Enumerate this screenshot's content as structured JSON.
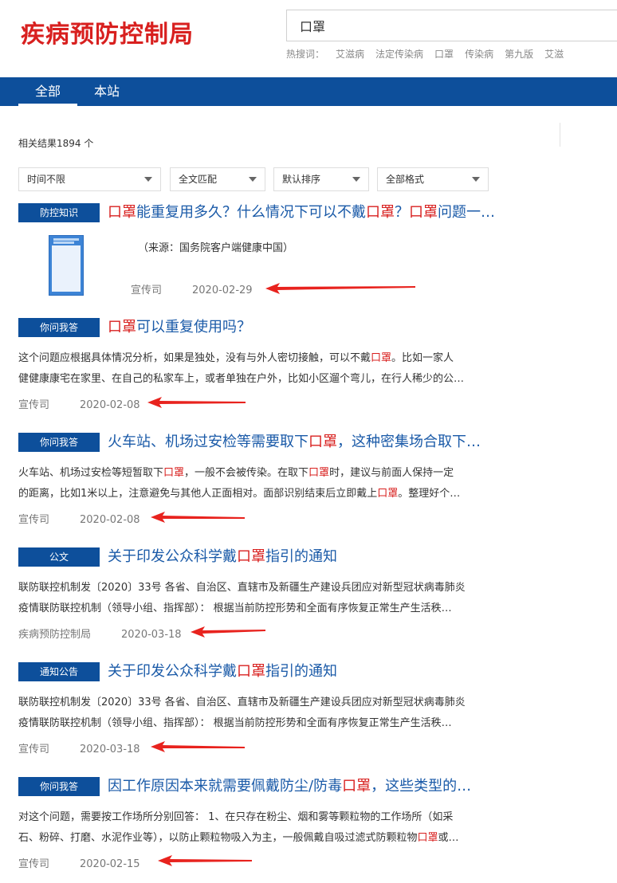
{
  "header": {
    "logo": "疾病预防控制局",
    "search_value": "口罩",
    "hot_label": "热搜词：",
    "hot_words": [
      "艾滋病",
      "法定传染病",
      "口罩",
      "传染病",
      "第九版",
      "艾滋"
    ]
  },
  "nav": {
    "tab_all": "全部",
    "tab_site": "本站"
  },
  "result_count": "相关结果1894 个",
  "filters": {
    "time": "时间不限",
    "match": "全文匹配",
    "sort": "默认排序",
    "format": "全部格式"
  },
  "results": [
    {
      "badge": "防控知识",
      "title": [
        {
          "t": "口罩",
          "h": true
        },
        {
          "t": "能重复用多久？什么情况下可以不戴",
          "h": false
        },
        {
          "t": "口罩",
          "h": true
        },
        {
          "t": "？",
          "h": false
        },
        {
          "t": "口罩",
          "h": true
        },
        {
          "t": "问题一…",
          "h": false
        }
      ],
      "source": "（来源：国务院客户端健康中国）",
      "author": "宣传司",
      "date": "2020-02-29"
    },
    {
      "badge": "你问我答",
      "title": [
        {
          "t": "口罩",
          "h": true
        },
        {
          "t": "可以重复使用吗？",
          "h": false
        }
      ],
      "snippet1": [
        {
          "t": "这个问题应根据具体情况分析，如果是独处，没有与外人密切接触，可以不戴",
          "h": false
        },
        {
          "t": "口罩",
          "h": true
        },
        {
          "t": "。比如一家人",
          "h": false
        }
      ],
      "snippet2": [
        {
          "t": "健健康康宅在家里、在自己的私家车上，或者单独在户外，比如小区遛个弯儿，在行人稀少的公…",
          "h": false
        }
      ],
      "author": "宣传司",
      "date": "2020-02-08"
    },
    {
      "badge": "你问我答",
      "title": [
        {
          "t": "火车站、机场过安检等需要取下",
          "h": false
        },
        {
          "t": "口罩",
          "h": true
        },
        {
          "t": "，这种密集场合取下…",
          "h": false
        }
      ],
      "snippet1": [
        {
          "t": "火车站、机场过安检等短暂取下",
          "h": false
        },
        {
          "t": "口罩",
          "h": true
        },
        {
          "t": "，一般不会被传染。在取下",
          "h": false
        },
        {
          "t": "口罩",
          "h": true
        },
        {
          "t": "时，建议与前面人保持一定",
          "h": false
        }
      ],
      "snippet2": [
        {
          "t": "的距离，比如1米以上，注意避免与其他人正面相对。面部识别结束后立即戴上",
          "h": false
        },
        {
          "t": "口罩",
          "h": true
        },
        {
          "t": "。整理好个…",
          "h": false
        }
      ],
      "author": "宣传司",
      "date": "2020-02-08"
    },
    {
      "badge": "公文",
      "title": [
        {
          "t": "关于印发公众科学戴",
          "h": false
        },
        {
          "t": "口罩",
          "h": true
        },
        {
          "t": "指引的通知",
          "h": false
        }
      ],
      "snippet1": [
        {
          "t": "联防联控机制发〔2020〕33号 各省、自治区、直辖市及新疆生产建设兵团应对新型冠状病毒肺炎",
          "h": false
        }
      ],
      "snippet2": [
        {
          "t": "疫情联防联控机制（领导小组、指挥部）： 根据当前防控形势和全面有序恢复正常生产生活秩…",
          "h": false
        }
      ],
      "author": "疾病预防控制局",
      "date": "2020-03-18"
    },
    {
      "badge": "通知公告",
      "title": [
        {
          "t": "关于印发公众科学戴",
          "h": false
        },
        {
          "t": "口罩",
          "h": true
        },
        {
          "t": "指引的通知",
          "h": false
        }
      ],
      "snippet1": [
        {
          "t": "联防联控机制发〔2020〕33号 各省、自治区、直辖市及新疆生产建设兵团应对新型冠状病毒肺炎",
          "h": false
        }
      ],
      "snippet2": [
        {
          "t": "疫情联防联控机制（领导小组、指挥部）： 根据当前防控形势和全面有序恢复正常生产生活秩…",
          "h": false
        }
      ],
      "author": "宣传司",
      "date": "2020-03-18"
    },
    {
      "badge": "你问我答",
      "title": [
        {
          "t": "因工作原因本来就需要佩戴防尘/防毒",
          "h": false
        },
        {
          "t": "口罩",
          "h": true
        },
        {
          "t": "，这些类型的…",
          "h": false
        }
      ],
      "snippet1": [
        {
          "t": "对这个问题，需要按工作场所分别回答： 1、在只存在粉尘、烟和雾等颗粒物的工作场所（如采",
          "h": false
        }
      ],
      "snippet2": [
        {
          "t": "石、粉碎、打磨、水泥作业等），以防止颗粒物吸入为主，一般佩戴自吸过滤式防颗粒物",
          "h": false
        },
        {
          "t": "口罩",
          "h": true
        },
        {
          "t": "或…",
          "h": false
        }
      ],
      "author": "宣传司",
      "date": "2020-02-15"
    }
  ],
  "colors": {
    "brand_red": "#d8201f",
    "nav_blue": "#0d4f9b",
    "title_blue": "#1a5aa8",
    "arrow_red": "#e8231e"
  }
}
